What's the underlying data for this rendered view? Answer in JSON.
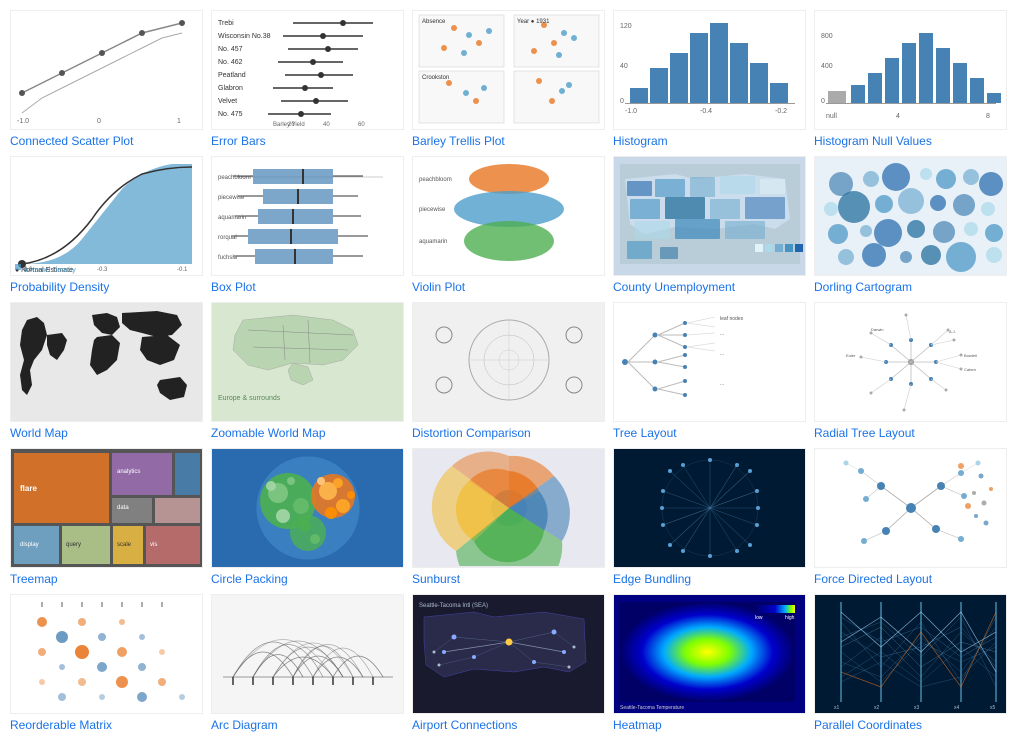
{
  "gallery": {
    "items": [
      {
        "id": "connected-scatter",
        "label": "Connected Scatter Plot",
        "thumb_type": "scatter"
      },
      {
        "id": "error-bars",
        "label": "Error Bars",
        "thumb_type": "errorbars"
      },
      {
        "id": "barley-trellis",
        "label": "Barley Trellis Plot",
        "thumb_type": "barley"
      },
      {
        "id": "histogram",
        "label": "Histogram",
        "thumb_type": "histogram"
      },
      {
        "id": "histogram-null",
        "label": "Histogram Null Values",
        "thumb_type": "histnull"
      },
      {
        "id": "prob-density",
        "label": "Probability Density",
        "thumb_type": "probdensity"
      },
      {
        "id": "box-plot",
        "label": "Box Plot",
        "thumb_type": "boxplot"
      },
      {
        "id": "violin-plot",
        "label": "Violin Plot",
        "thumb_type": "violin"
      },
      {
        "id": "county-unemployment",
        "label": "County Unemployment",
        "thumb_type": "countyunemployment"
      },
      {
        "id": "dorling-cartogram",
        "label": "Dorling Cartogram",
        "thumb_type": "dorling"
      },
      {
        "id": "world-map",
        "label": "World Map",
        "thumb_type": "worldmap"
      },
      {
        "id": "zoomable-world-map",
        "label": "Zoomable World Map",
        "thumb_type": "zoomableworld"
      },
      {
        "id": "distortion-comparison",
        "label": "Distortion Comparison",
        "thumb_type": "distortion"
      },
      {
        "id": "tree-layout",
        "label": "Tree Layout",
        "thumb_type": "treelayout"
      },
      {
        "id": "radial-tree-layout",
        "label": "Radial Tree Layout",
        "thumb_type": "radialtree"
      },
      {
        "id": "treemap",
        "label": "Treemap",
        "thumb_type": "treemap"
      },
      {
        "id": "circle-packing",
        "label": "Circle Packing",
        "thumb_type": "circlepacking"
      },
      {
        "id": "sunburst",
        "label": "Sunburst",
        "thumb_type": "sunburst"
      },
      {
        "id": "edge-bundling",
        "label": "Edge Bundling",
        "thumb_type": "edgebundling"
      },
      {
        "id": "force-directed-layout",
        "label": "Force Directed Layout",
        "thumb_type": "forcedirected"
      },
      {
        "id": "reorderable-matrix",
        "label": "Reorderable Matrix",
        "thumb_type": "reorderablematrix"
      },
      {
        "id": "arc-diagram",
        "label": "Arc Diagram",
        "thumb_type": "arcdiagram"
      },
      {
        "id": "airport-connections",
        "label": "Airport Connections",
        "thumb_type": "airportconnections"
      },
      {
        "id": "heatmap",
        "label": "Heatmap",
        "thumb_type": "heatmap"
      },
      {
        "id": "parallel-coordinates",
        "label": "Parallel Coordinates",
        "thumb_type": "parallelcoords"
      }
    ]
  }
}
